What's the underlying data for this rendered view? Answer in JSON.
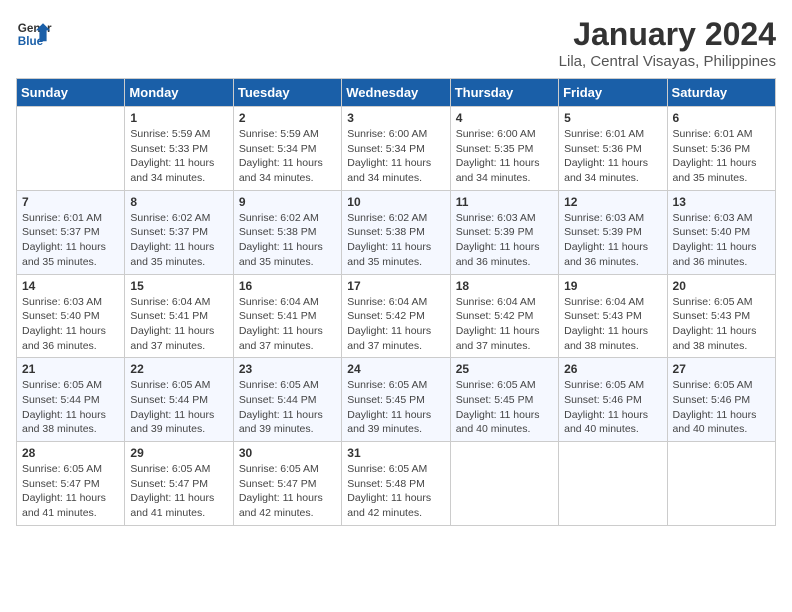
{
  "header": {
    "logo_line1": "General",
    "logo_line2": "Blue",
    "month_title": "January 2024",
    "location": "Lila, Central Visayas, Philippines"
  },
  "weekdays": [
    "Sunday",
    "Monday",
    "Tuesday",
    "Wednesday",
    "Thursday",
    "Friday",
    "Saturday"
  ],
  "weeks": [
    [
      {
        "day": "",
        "info": ""
      },
      {
        "day": "1",
        "info": "Sunrise: 5:59 AM\nSunset: 5:33 PM\nDaylight: 11 hours\nand 34 minutes."
      },
      {
        "day": "2",
        "info": "Sunrise: 5:59 AM\nSunset: 5:34 PM\nDaylight: 11 hours\nand 34 minutes."
      },
      {
        "day": "3",
        "info": "Sunrise: 6:00 AM\nSunset: 5:34 PM\nDaylight: 11 hours\nand 34 minutes."
      },
      {
        "day": "4",
        "info": "Sunrise: 6:00 AM\nSunset: 5:35 PM\nDaylight: 11 hours\nand 34 minutes."
      },
      {
        "day": "5",
        "info": "Sunrise: 6:01 AM\nSunset: 5:36 PM\nDaylight: 11 hours\nand 34 minutes."
      },
      {
        "day": "6",
        "info": "Sunrise: 6:01 AM\nSunset: 5:36 PM\nDaylight: 11 hours\nand 35 minutes."
      }
    ],
    [
      {
        "day": "7",
        "info": "Sunrise: 6:01 AM\nSunset: 5:37 PM\nDaylight: 11 hours\nand 35 minutes."
      },
      {
        "day": "8",
        "info": "Sunrise: 6:02 AM\nSunset: 5:37 PM\nDaylight: 11 hours\nand 35 minutes."
      },
      {
        "day": "9",
        "info": "Sunrise: 6:02 AM\nSunset: 5:38 PM\nDaylight: 11 hours\nand 35 minutes."
      },
      {
        "day": "10",
        "info": "Sunrise: 6:02 AM\nSunset: 5:38 PM\nDaylight: 11 hours\nand 35 minutes."
      },
      {
        "day": "11",
        "info": "Sunrise: 6:03 AM\nSunset: 5:39 PM\nDaylight: 11 hours\nand 36 minutes."
      },
      {
        "day": "12",
        "info": "Sunrise: 6:03 AM\nSunset: 5:39 PM\nDaylight: 11 hours\nand 36 minutes."
      },
      {
        "day": "13",
        "info": "Sunrise: 6:03 AM\nSunset: 5:40 PM\nDaylight: 11 hours\nand 36 minutes."
      }
    ],
    [
      {
        "day": "14",
        "info": "Sunrise: 6:03 AM\nSunset: 5:40 PM\nDaylight: 11 hours\nand 36 minutes."
      },
      {
        "day": "15",
        "info": "Sunrise: 6:04 AM\nSunset: 5:41 PM\nDaylight: 11 hours\nand 37 minutes."
      },
      {
        "day": "16",
        "info": "Sunrise: 6:04 AM\nSunset: 5:41 PM\nDaylight: 11 hours\nand 37 minutes."
      },
      {
        "day": "17",
        "info": "Sunrise: 6:04 AM\nSunset: 5:42 PM\nDaylight: 11 hours\nand 37 minutes."
      },
      {
        "day": "18",
        "info": "Sunrise: 6:04 AM\nSunset: 5:42 PM\nDaylight: 11 hours\nand 37 minutes."
      },
      {
        "day": "19",
        "info": "Sunrise: 6:04 AM\nSunset: 5:43 PM\nDaylight: 11 hours\nand 38 minutes."
      },
      {
        "day": "20",
        "info": "Sunrise: 6:05 AM\nSunset: 5:43 PM\nDaylight: 11 hours\nand 38 minutes."
      }
    ],
    [
      {
        "day": "21",
        "info": "Sunrise: 6:05 AM\nSunset: 5:44 PM\nDaylight: 11 hours\nand 38 minutes."
      },
      {
        "day": "22",
        "info": "Sunrise: 6:05 AM\nSunset: 5:44 PM\nDaylight: 11 hours\nand 39 minutes."
      },
      {
        "day": "23",
        "info": "Sunrise: 6:05 AM\nSunset: 5:44 PM\nDaylight: 11 hours\nand 39 minutes."
      },
      {
        "day": "24",
        "info": "Sunrise: 6:05 AM\nSunset: 5:45 PM\nDaylight: 11 hours\nand 39 minutes."
      },
      {
        "day": "25",
        "info": "Sunrise: 6:05 AM\nSunset: 5:45 PM\nDaylight: 11 hours\nand 40 minutes."
      },
      {
        "day": "26",
        "info": "Sunrise: 6:05 AM\nSunset: 5:46 PM\nDaylight: 11 hours\nand 40 minutes."
      },
      {
        "day": "27",
        "info": "Sunrise: 6:05 AM\nSunset: 5:46 PM\nDaylight: 11 hours\nand 40 minutes."
      }
    ],
    [
      {
        "day": "28",
        "info": "Sunrise: 6:05 AM\nSunset: 5:47 PM\nDaylight: 11 hours\nand 41 minutes."
      },
      {
        "day": "29",
        "info": "Sunrise: 6:05 AM\nSunset: 5:47 PM\nDaylight: 11 hours\nand 41 minutes."
      },
      {
        "day": "30",
        "info": "Sunrise: 6:05 AM\nSunset: 5:47 PM\nDaylight: 11 hours\nand 42 minutes."
      },
      {
        "day": "31",
        "info": "Sunrise: 6:05 AM\nSunset: 5:48 PM\nDaylight: 11 hours\nand 42 minutes."
      },
      {
        "day": "",
        "info": ""
      },
      {
        "day": "",
        "info": ""
      },
      {
        "day": "",
        "info": ""
      }
    ]
  ]
}
